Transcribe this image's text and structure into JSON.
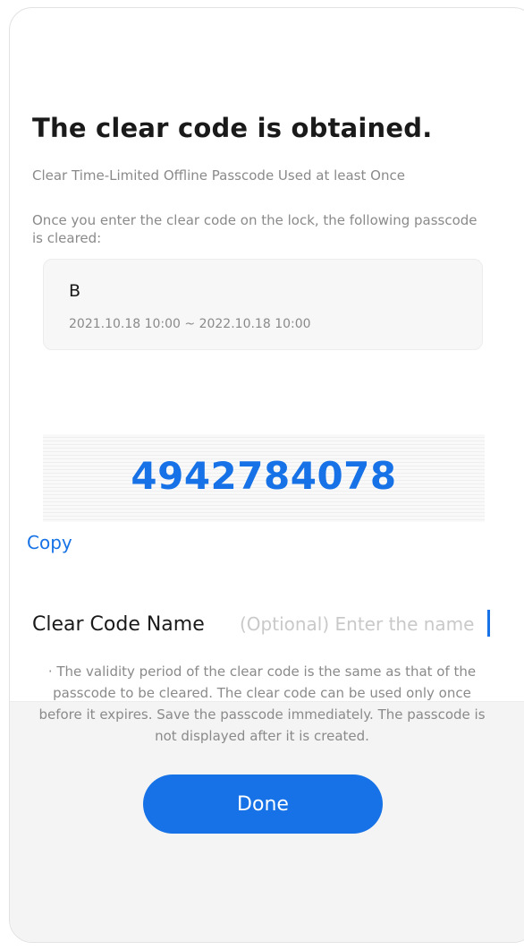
{
  "header": {
    "title": "The clear code is obtained.",
    "subtitle": "Clear Time-Limited Offline Passcode Used at least Once"
  },
  "description": "Once you enter the clear code on the lock, the following passcode is cleared:",
  "passcode": {
    "name": "B",
    "validity_period": "2021.10.18 10:00 ~ 2022.10.18 10:00"
  },
  "clear_code": "4942784078",
  "copy_label": "Copy",
  "clear_code_name": {
    "label": "Clear Code Name",
    "placeholder": "(Optional) Enter the name",
    "value": ""
  },
  "notice_lines": [
    "· The validity period of the clear code is the same as that of the",
    "passcode to be cleared. The clear code can be used only once",
    "before it expires. Save the  passcode immediately. The passcode is",
    "not displayed after it is created."
  ],
  "done_label": "Done",
  "colors": {
    "accent": "#1672e6",
    "text_primary": "#1a1a1a",
    "text_secondary": "#8a8a8a",
    "placeholder": "#c9c9c9",
    "background_band": "#f4f4f4"
  }
}
